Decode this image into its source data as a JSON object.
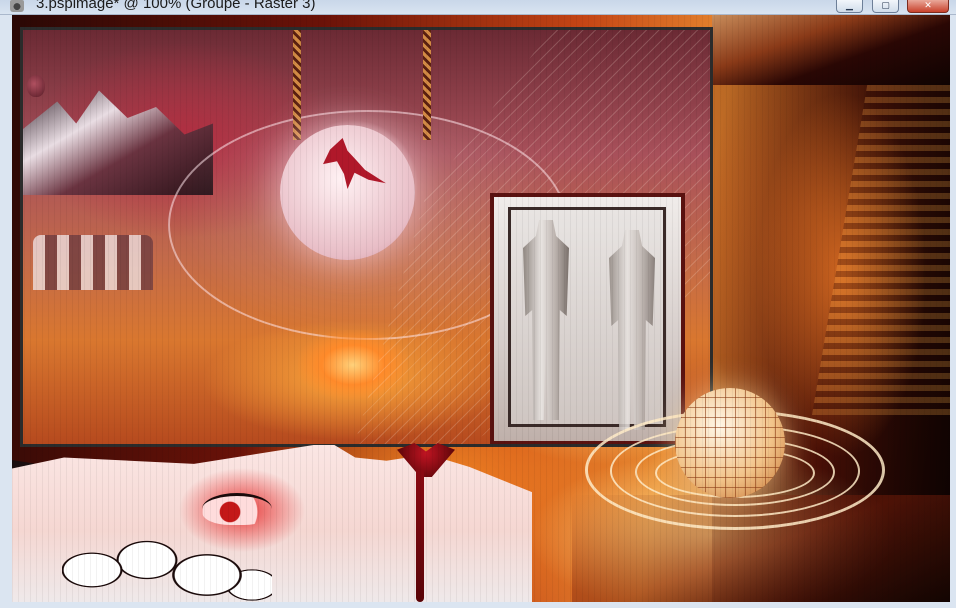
{
  "window": {
    "title": "3.pspimage* @ 100% (Groupe - Raster 3)",
    "app_icon": "camera-icon",
    "controls": {
      "minimize_glyph": "▁",
      "maximize_glyph": "▢",
      "close_glyph": "✕"
    }
  },
  "canvas": {
    "zoom": "100%",
    "layer_group": "Groupe",
    "active_layer": "Raster 3"
  },
  "colors": {
    "dark_red": "#5a1210",
    "orange": "#e88a30",
    "titlebar": "#d0dcea",
    "close_button": "#c8422c"
  }
}
